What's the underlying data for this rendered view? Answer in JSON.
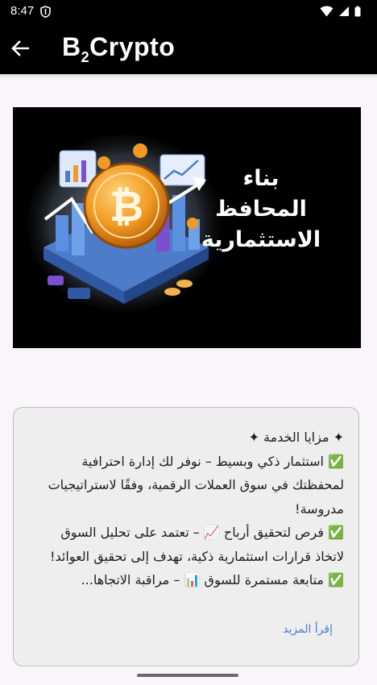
{
  "status_bar": {
    "time": "8:47"
  },
  "app_bar": {
    "title_main": "B",
    "title_sub": "2",
    "title_rest": "Crypto"
  },
  "banner": {
    "coin_symbol": "₿",
    "text_line1": "بناء المحافظ",
    "text_line2": "الاستثمارية"
  },
  "card": {
    "heading": "✦ مزايا الخدمة ✦",
    "para1": "✅ استثمار ذكي وبسيط – نوفر لك إدارة احترافية لمحفظتك في سوق العملات الرقمية، وفقًا لاستراتيجيات مدروسة!",
    "para2": "✅ فرص لتحقيق أرباح 📈 – تعتمد على تحليل السوق لاتخاذ قرارات استثمارية ذكية، تهدف إلى تحقيق العوائد!",
    "para3": "✅ متابعة مستمرة للسوق 📊 – مراقبة الاتجاها...",
    "read_more": "إقرأ المزيد"
  },
  "colors": {
    "accent_link": "#4a7bd0",
    "app_bar": "#000000",
    "background": "#faf5fb"
  }
}
